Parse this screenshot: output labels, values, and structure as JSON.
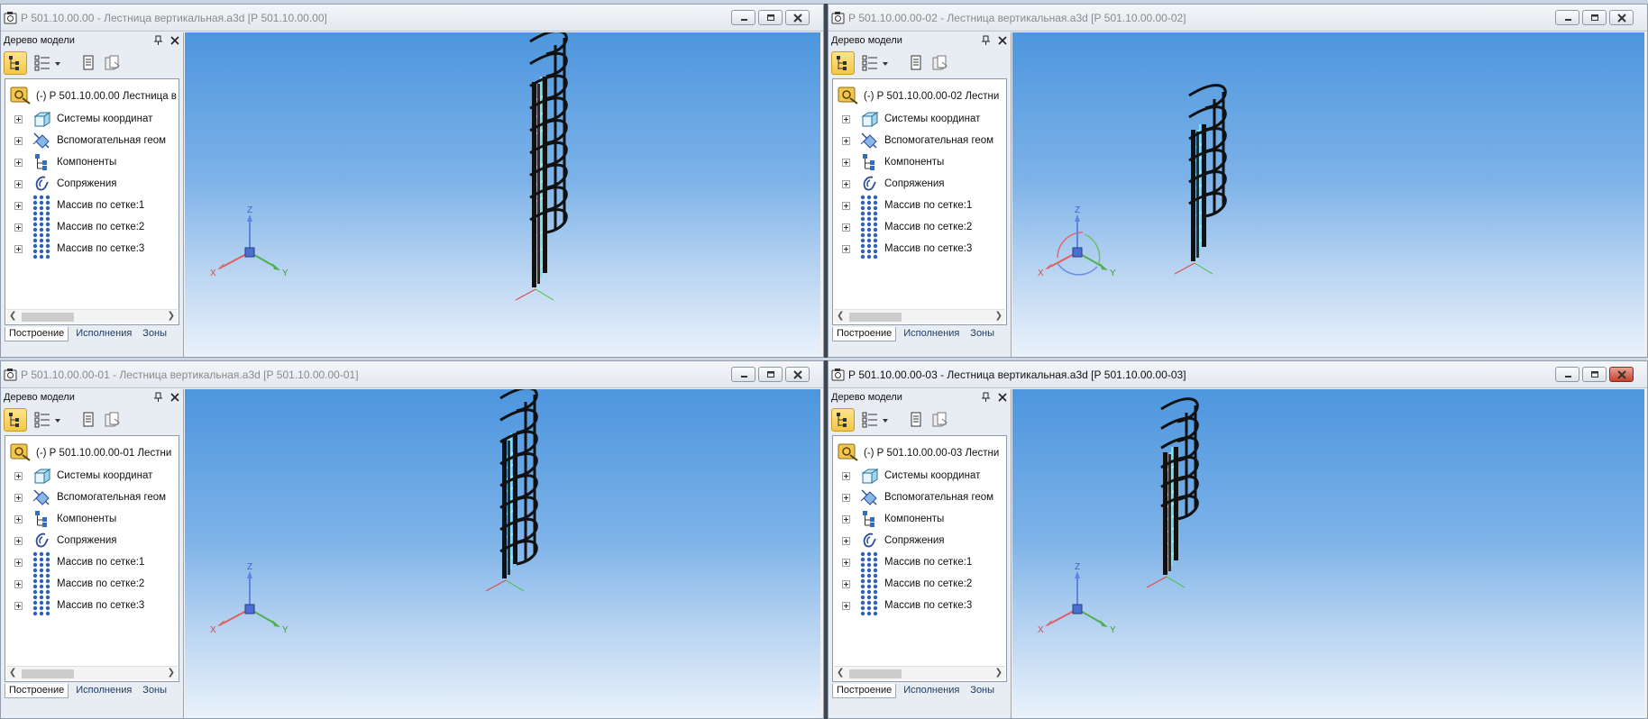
{
  "windows": [
    {
      "title": "Р 501.10.00.00 - Лестница вертикальная.a3d [Р 501.10.00.00]",
      "active": false,
      "root_label": "(-) Р 501.10.00.00 Лестница в",
      "tree_axis_mode": "plain"
    },
    {
      "title": "Р 501.10.00.00-02 - Лестница вертикальная.a3d [Р 501.10.00.00-02]",
      "active": false,
      "root_label": "(-) Р 501.10.00.00-02 Лестни",
      "tree_axis_mode": "rotate"
    },
    {
      "title": "Р 501.10.00.00-01 - Лестница вертикальная.a3d [Р 501.10.00.00-01]",
      "active": false,
      "root_label": "(-) Р 501.10.00.00-01 Лестни",
      "tree_axis_mode": "plain"
    },
    {
      "title": "Р 501.10.00.00-03 - Лестница вертикальная.a3d [Р 501.10.00.00-03]",
      "active": true,
      "root_label": "(-) Р 501.10.00.00-03 Лестни",
      "tree_axis_mode": "plain"
    }
  ],
  "panel": {
    "header": "Дерево модели"
  },
  "tree_items": [
    {
      "label": "Системы координат",
      "icon": "coordinate-system-icon"
    },
    {
      "label": "Вспомогательная геом",
      "icon": "auxiliary-geometry-icon"
    },
    {
      "label": "Компоненты",
      "icon": "components-icon"
    },
    {
      "label": "Сопряжения",
      "icon": "mates-icon"
    },
    {
      "label": "Массив по сетке:1",
      "icon": "grid-array-icon"
    },
    {
      "label": "Массив по сетке:2",
      "icon": "grid-array-icon"
    },
    {
      "label": "Массив по сетке:3",
      "icon": "grid-array-icon"
    }
  ],
  "tabs": [
    "Построение",
    "Исполнения",
    "Зоны"
  ],
  "axis_labels": {
    "x": "X",
    "y": "Y",
    "z": "Z"
  },
  "colors": {
    "active_title": "#111111",
    "inactive_title": "#8a8a8a",
    "selected_tool": "#f4c744",
    "viewport_top": "#4d96de",
    "viewport_bottom": "#eaf2fb"
  }
}
